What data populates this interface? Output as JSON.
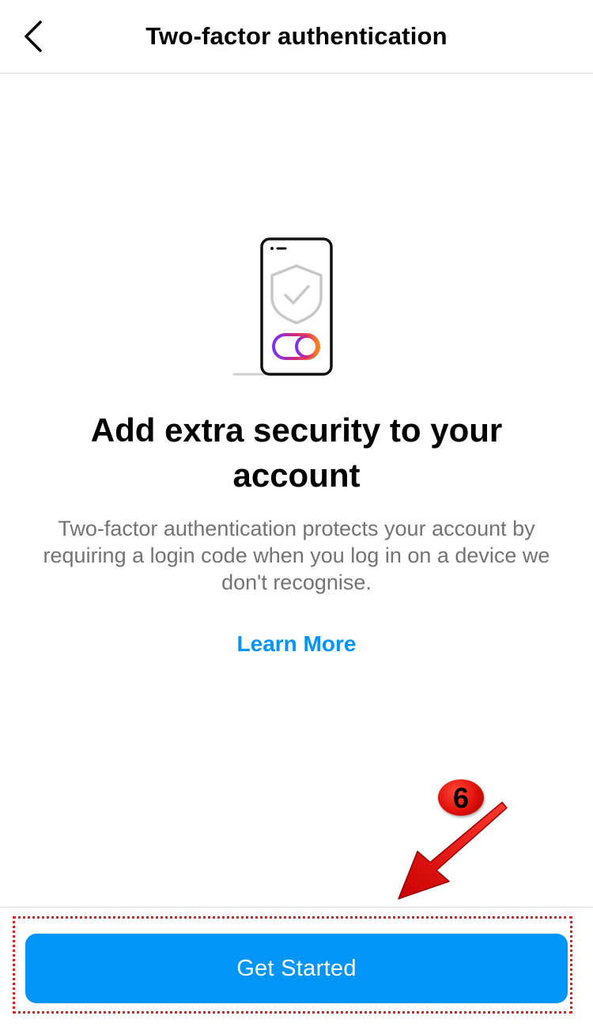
{
  "header": {
    "title": "Two-factor authentication",
    "back_icon": "chevron-left-icon"
  },
  "illustration": {
    "icon": "phone-shield-toggle-icon",
    "gradient_colors": [
      "#7b2ff7",
      "#d62976",
      "#fa7e1e"
    ]
  },
  "content": {
    "headline": "Add extra security to your account",
    "description": "Two-factor authentication protects your account by requiring a login code when you log in on a device we don't recognise.",
    "learn_more": "Learn More"
  },
  "annotation": {
    "step_number": "6",
    "color": "#e0201a"
  },
  "footer": {
    "primary_button": "Get Started"
  },
  "colors": {
    "accent": "#0095f6",
    "secondary_text": "#737373",
    "divider": "#dbdbdb"
  }
}
